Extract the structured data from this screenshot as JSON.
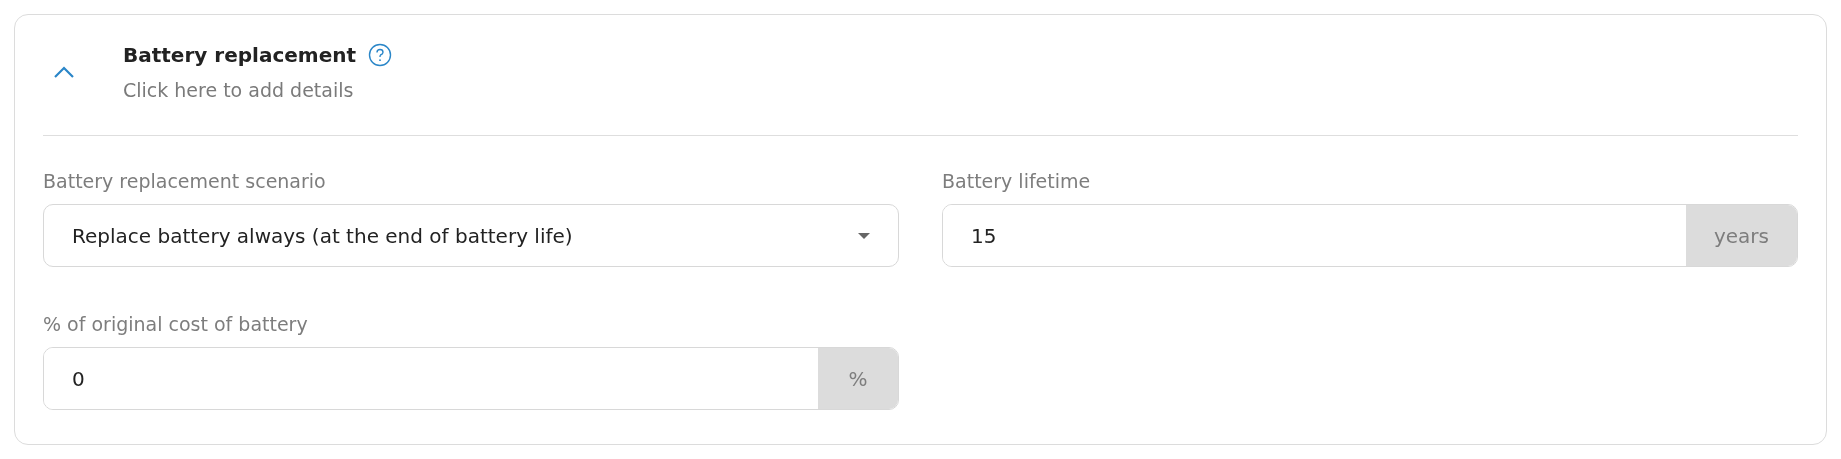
{
  "section": {
    "title": "Battery replacement",
    "subtitle": "Click here to add details",
    "expanded": true,
    "fields": [
      {
        "kind": "select",
        "label": "Battery replacement scenario",
        "value": "Replace battery always (at the end of battery life)"
      },
      {
        "kind": "addon",
        "label": "Battery lifetime",
        "value": "15",
        "unit": "years"
      },
      {
        "kind": "addon",
        "label": "% of original cost of battery",
        "value": "0",
        "unit": "%"
      }
    ]
  }
}
